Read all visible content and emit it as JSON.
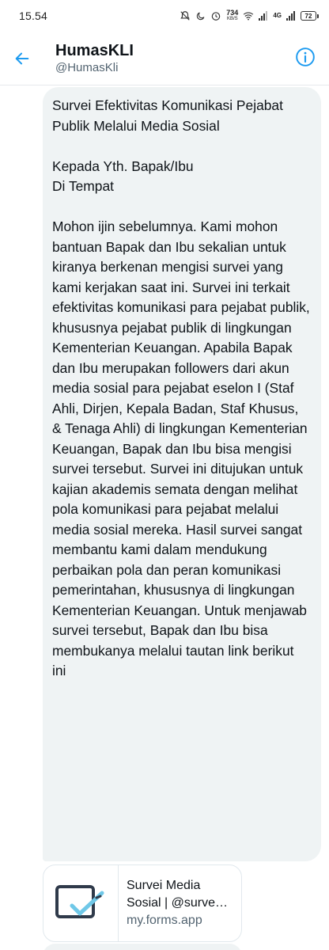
{
  "status_bar": {
    "time": "15.54",
    "net_speed": "734",
    "net_speed_unit": "KB/S",
    "net_type": "4G",
    "battery": "72"
  },
  "header": {
    "name": "HumasKLI",
    "handle": "@HumasKli"
  },
  "message": {
    "text": "Survei Efektivitas Komunikasi Pejabat Publik Melalui Media Sosial\n\nKepada Yth. Bapak/Ibu\nDi Tempat\n\nMohon ijin sebelumnya. Kami mohon bantuan Bapak dan Ibu sekalian untuk kiranya berkenan mengisi survei yang kami kerjakan saat ini. Survei ini terkait efektivitas komunikasi para pejabat publik, khususnya pejabat publik di lingkungan Kementerian Keuangan. Apabila Bapak dan Ibu merupakan followers dari akun media sosial para pejabat eselon I (Staf Ahli, Dirjen, Kepala Badan, Staf Khusus, & Tenaga Ahli) di lingkungan Kementerian Keuangan, Bapak dan Ibu bisa mengisi survei tersebut. Survei ini ditujukan untuk kajian akademis semata dengan melihat pola komunikasi para pejabat melalui media sosial mereka. Hasil survei sangat membantu kami dalam mendukung perbaikan pola dan peran komunikasi pemerintahan, khususnya di lingkungan Kementerian Keuangan. Untuk menjawab survei tersebut, Bapak dan Ibu bisa membukanya melalui tautan link berikut ini"
  },
  "link_card": {
    "title_line1": "Survei Media",
    "title_line2": "Sosial | @surve…",
    "domain": "my.forms.app"
  },
  "colors": {
    "accent": "#1d9bf0",
    "bubble_bg": "#eff3f4",
    "secondary_text": "#536471"
  }
}
